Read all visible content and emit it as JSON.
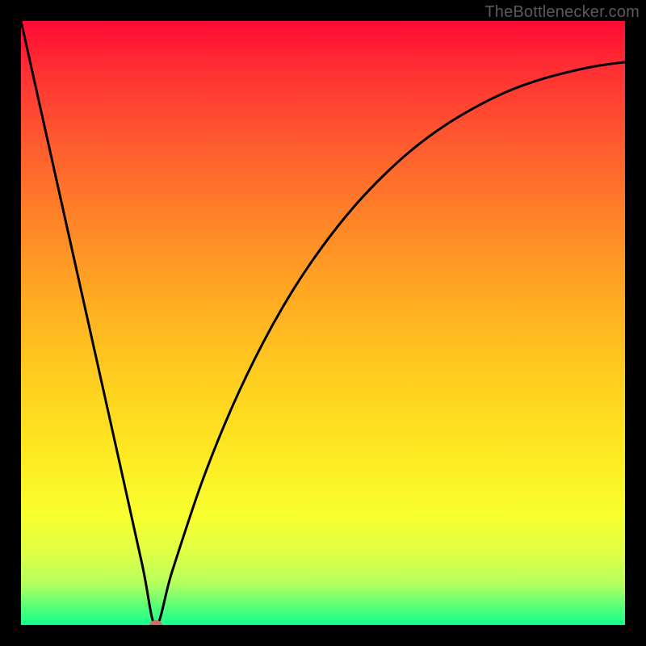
{
  "watermark": {
    "text": "TheBottlenecker.com"
  },
  "chart_data": {
    "type": "line",
    "title": "",
    "xlabel": "",
    "ylabel": "",
    "xlim": [
      0,
      100
    ],
    "ylim": [
      0,
      100
    ],
    "grid": false,
    "legend": false,
    "series": [
      {
        "name": "bottleneck-curve",
        "x": [
          0,
          5,
          10,
          15,
          20,
          22.3,
          25,
          30,
          35,
          40,
          45,
          50,
          55,
          60,
          65,
          70,
          75,
          80,
          85,
          90,
          95,
          100
        ],
        "y": [
          100,
          77.6,
          55.2,
          32.8,
          10.3,
          0,
          8.8,
          23.8,
          36.2,
          46.6,
          55.4,
          62.8,
          69.1,
          74.4,
          78.9,
          82.6,
          85.6,
          88.1,
          90.0,
          91.4,
          92.5,
          93.2
        ]
      }
    ],
    "marker": {
      "x": 22.3,
      "y": 0,
      "color": "#c97262"
    },
    "gradient_stops": [
      {
        "pos": 0.0,
        "color": "#ff0a34"
      },
      {
        "pos": 0.5,
        "color": "#ffab22"
      },
      {
        "pos": 0.82,
        "color": "#f8ff2f"
      },
      {
        "pos": 1.0,
        "color": "#12ff8e"
      }
    ]
  }
}
